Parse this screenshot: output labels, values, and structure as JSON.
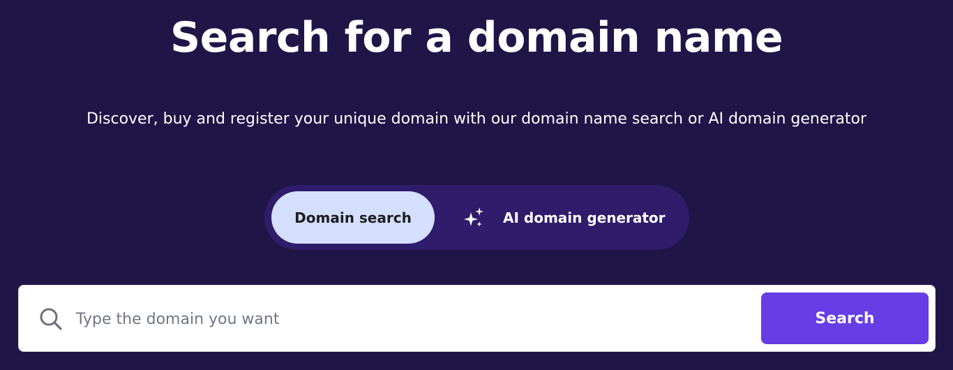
{
  "hero": {
    "title": "Search for a domain name",
    "subtitle": "Discover, buy and register your unique domain with our domain name search or AI domain generator"
  },
  "mode_toggle": {
    "options": [
      {
        "label": "Domain search",
        "active": true
      },
      {
        "label": "AI domain generator",
        "active": false,
        "icon": "sparkle-icon"
      }
    ]
  },
  "search": {
    "icon": "search-icon",
    "placeholder": "Type the domain you want",
    "value": "",
    "button_label": "Search"
  },
  "colors": {
    "background": "#1f1547",
    "toggle_track": "#2f1c6a",
    "toggle_active": "#d5dfff",
    "accent": "#673de6",
    "placeholder": "#727586"
  }
}
